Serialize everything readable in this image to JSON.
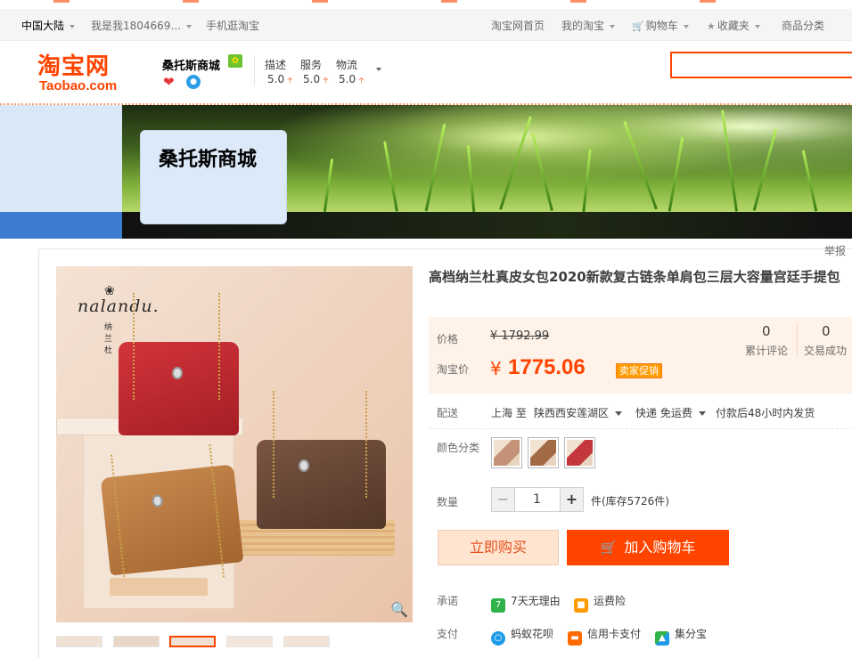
{
  "topbar": {
    "region": "中国大陆",
    "user": "我是我1804669...",
    "mobile": "手机逛淘宝",
    "home": "淘宝网首页",
    "my_taobao": "我的淘宝",
    "cart": "购物车",
    "favorites": "收藏夹",
    "categories": "商品分类"
  },
  "header": {
    "logo_cn": "淘宝网",
    "logo_en": "Taobao.com",
    "shop_name": "桑托斯商城",
    "ratings": [
      {
        "label": "描述",
        "value": "5.0"
      },
      {
        "label": "服务",
        "value": "5.0"
      },
      {
        "label": "物流",
        "value": "5.0"
      }
    ],
    "search_value": ""
  },
  "banner": {
    "shop_title": "桑托斯商城"
  },
  "report": "举报",
  "product": {
    "brand_en": "nalandu.",
    "brand_cn": "纳兰杜",
    "title": "高档纳兰杜真皮女包2020新款复古链条单肩包三层大容量宫廷手提包",
    "price_label": "价格",
    "original_price": "¥ 1792.99",
    "promo_label": "淘宝价",
    "currency": "¥",
    "current_price": "1775.06",
    "promo_tag": "卖家促销",
    "reviews_count": "0",
    "reviews_label": "累计评论",
    "sales_count": "0",
    "sales_label": "交易成功"
  },
  "shipping": {
    "label": "配送",
    "from": "上海 至",
    "to": "陕西西安莲湖区",
    "method": "快递 免运费",
    "promise": "付款后48小时内发货"
  },
  "sku": {
    "label": "颜色分类",
    "options": [
      {
        "color": "#c49276"
      },
      {
        "color": "#a26a44"
      },
      {
        "color": "#c4373b"
      }
    ]
  },
  "quantity": {
    "label": "数量",
    "value": "1",
    "minus": "−",
    "plus": "+",
    "stock": "件(库存5726件)"
  },
  "actions": {
    "buy_now": "立即购买",
    "add_to_cart": "加入购物车"
  },
  "services": {
    "promise_label": "承诺",
    "promise_items": [
      "7天无理由",
      "运费险"
    ],
    "payment_label": "支付",
    "payment_items": [
      "蚂蚁花呗",
      "信用卡支付",
      "集分宝"
    ]
  },
  "colors": {
    "accent": "#ff4400",
    "price_bg": "#fff2e8",
    "buy_bg": "#ffe4d0"
  }
}
